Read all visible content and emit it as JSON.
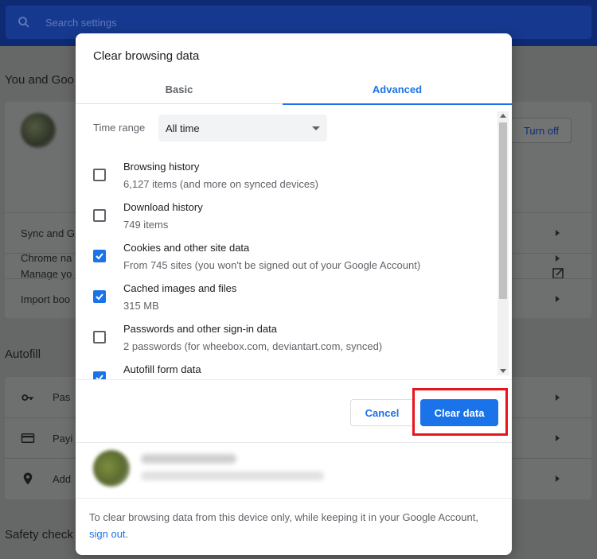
{
  "background": {
    "search_placeholder": "Search settings",
    "section_you": "You and Goo",
    "turn_off_label": "Turn off",
    "rows_you": [
      "Sync and G",
      "Manage yo",
      "Chrome na",
      "Import boo"
    ],
    "section_autofill": "Autofill",
    "rows_autofill": [
      "Pas",
      "Payi",
      "Add"
    ],
    "section_safety": "Safety check"
  },
  "dialog": {
    "title": "Clear browsing data",
    "tabs": [
      {
        "label": "Basic",
        "active": false
      },
      {
        "label": "Advanced",
        "active": true
      }
    ],
    "time_range": {
      "label": "Time range",
      "value": "All time"
    },
    "items": [
      {
        "title": "Browsing history",
        "subtitle": "6,127 items (and more on synced devices)",
        "checked": false
      },
      {
        "title": "Download history",
        "subtitle": "749 items",
        "checked": false
      },
      {
        "title": "Cookies and other site data",
        "subtitle": "From 745 sites (you won't be signed out of your Google Account)",
        "checked": true
      },
      {
        "title": "Cached images and files",
        "subtitle": "315 MB",
        "checked": true
      },
      {
        "title": "Passwords and other sign-in data",
        "subtitle": "2 passwords (for wheebox.com, deviantart.com, synced)",
        "checked": false
      },
      {
        "title": "Autofill form data",
        "subtitle": "",
        "checked": true
      }
    ],
    "buttons": {
      "cancel": "Cancel",
      "clear": "Clear data"
    },
    "footer": {
      "text": "To clear browsing data from this device only, while keeping it in your Google Account, ",
      "link": "sign out",
      "end": "."
    }
  },
  "colors": {
    "accent": "#1a73e8",
    "highlight": "#e8141d"
  }
}
